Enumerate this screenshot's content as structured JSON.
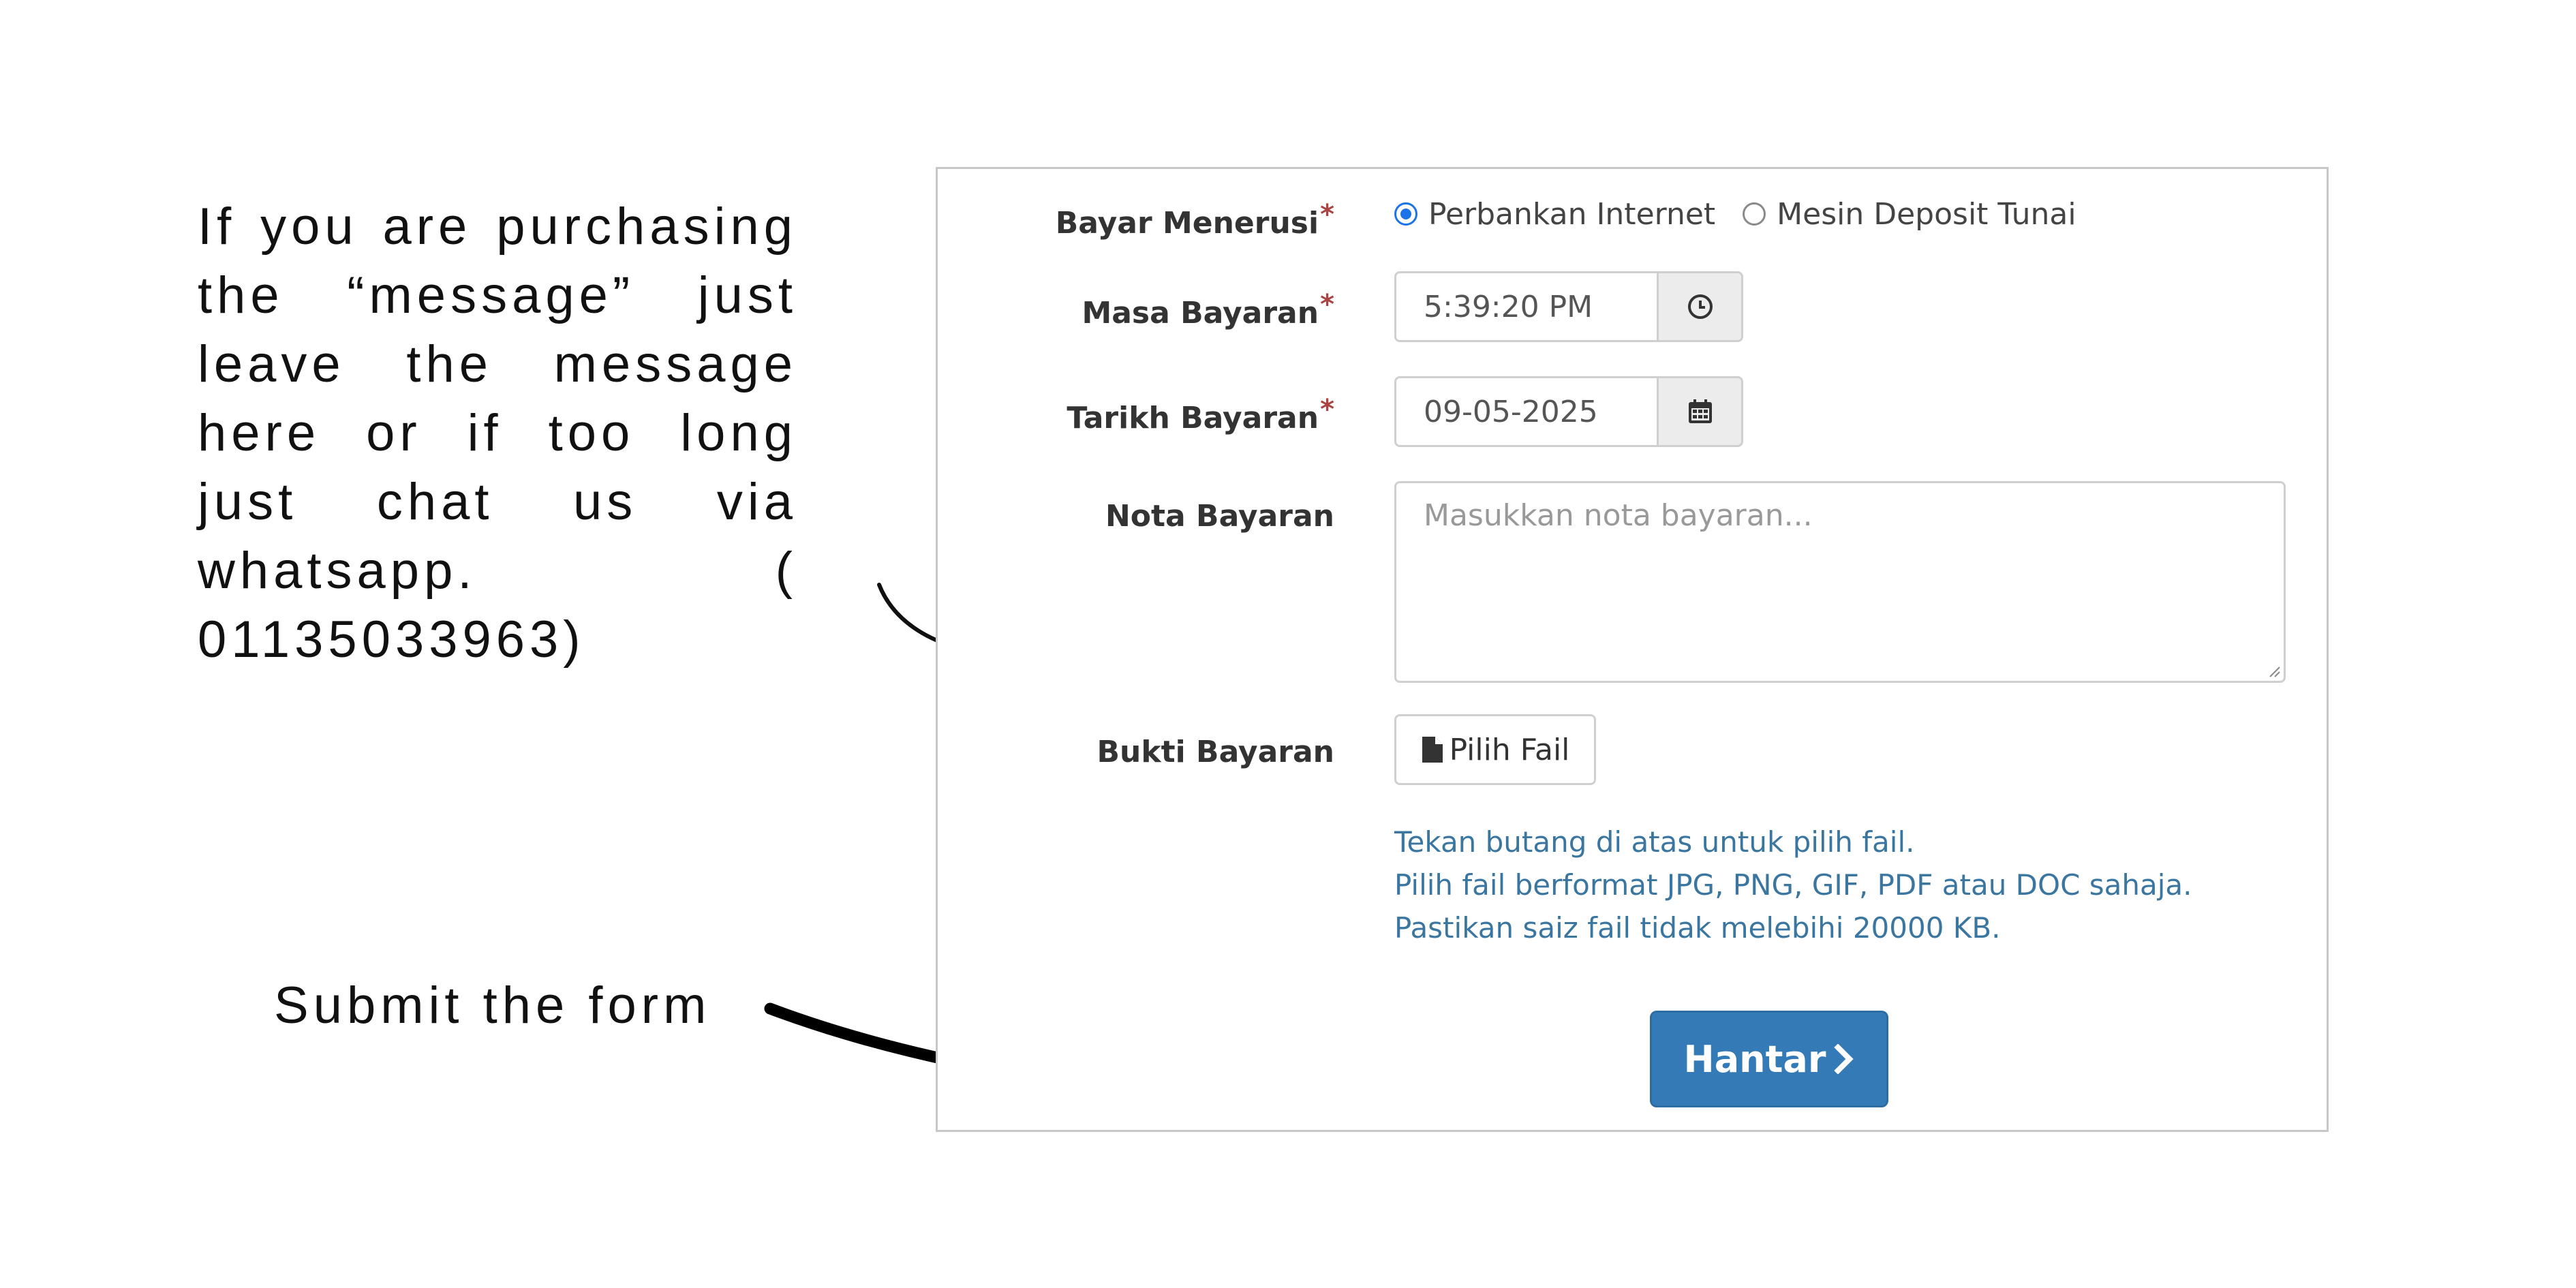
{
  "annotations": {
    "note_text": "If you are purchasing the “message” just leave the message here or if too long just chat us via whatsapp. ( 01135033963)",
    "submit_text": "Submit the form"
  },
  "form": {
    "payment_method": {
      "label": "Bayar Menerusi",
      "required_mark": "*",
      "options": [
        "Perbankan Internet",
        "Mesin Deposit Tunai"
      ],
      "selected": "Perbankan Internet"
    },
    "payment_time": {
      "label": "Masa Bayaran",
      "required_mark": "*",
      "value": "5:39:20 PM",
      "icon": "clock-icon"
    },
    "payment_date": {
      "label": "Tarikh Bayaran",
      "required_mark": "*",
      "value": "09-05-2025",
      "icon": "calendar-icon"
    },
    "payment_note": {
      "label": "Nota Bayaran",
      "placeholder": "Masukkan nota bayaran..."
    },
    "payment_proof": {
      "label": "Bukti Bayaran",
      "button_label": "Pilih Fail",
      "icon": "file-icon",
      "help": [
        "Tekan butang di atas untuk pilih fail.",
        "Pilih fail berformat JPG, PNG, GIF, PDF atau DOC sahaja.",
        "Pastikan saiz fail tidak melebihi 20000 KB."
      ]
    },
    "submit": {
      "label": "Hantar",
      "icon": "chevron-right-icon"
    }
  },
  "colors": {
    "primary": "#337ab7",
    "required": "#a94442",
    "help_text": "#3a76a0",
    "radio_selected": "#1a73e8"
  }
}
